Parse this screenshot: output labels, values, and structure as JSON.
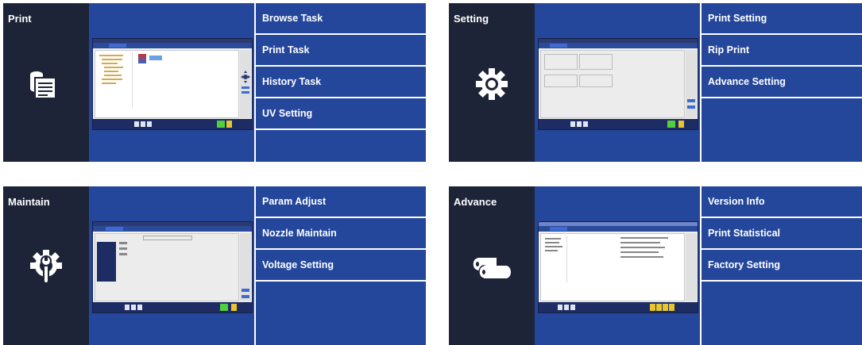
{
  "panels": [
    {
      "title": "Print",
      "icon": "printer-icon",
      "menu": [
        "Browse Task",
        "Print Task",
        "History Task",
        "UV Setting"
      ]
    },
    {
      "title": "Setting",
      "icon": "gear-icon",
      "menu": [
        "Print Setting",
        "Rip Print",
        "Advance Setting"
      ]
    },
    {
      "title": "Maintain",
      "icon": "wrench-gear-icon",
      "menu": [
        "Param Adjust",
        "Nozzle Maintain",
        "Voltage Setting"
      ]
    },
    {
      "title": "Advance",
      "icon": "rolls-icon",
      "menu": [
        "Version Info",
        "Print Statistical",
        "Factory Setting"
      ]
    }
  ],
  "colors": {
    "category_bg": "#1d2437",
    "menu_bg": "#24479c",
    "text": "#ffffff"
  }
}
